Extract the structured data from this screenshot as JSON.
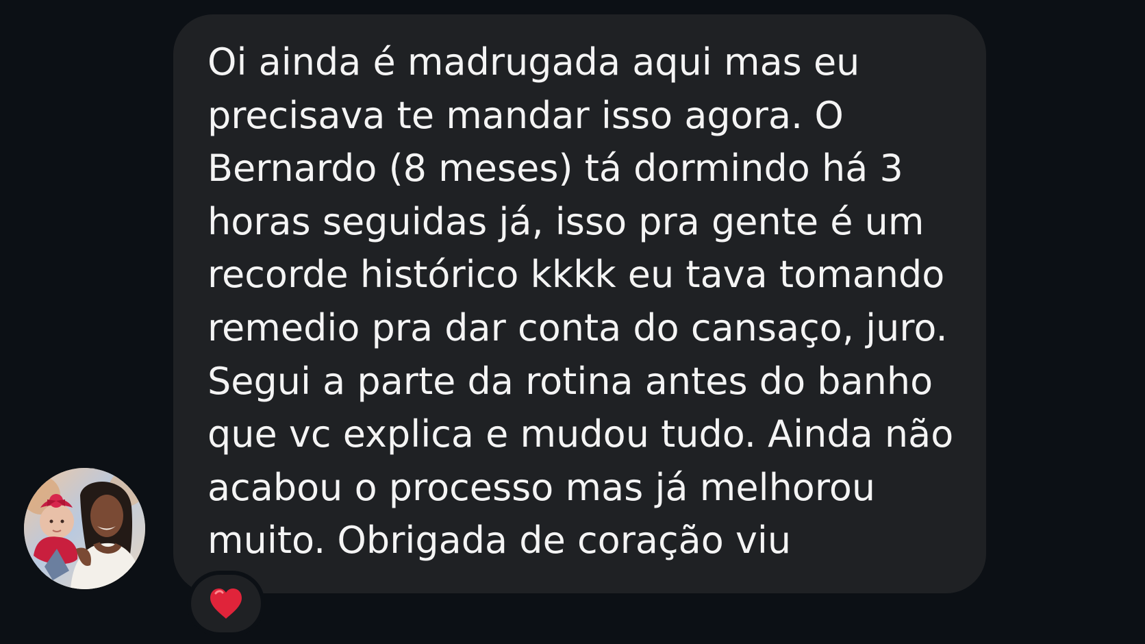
{
  "message": {
    "lines": [
      "Oi ainda é madrugada aqui mas eu",
      "precisava te mandar isso agora. O",
      "Bernardo (8 meses) tá dormindo há 3",
      "horas seguidas já, isso pra gente é um",
      "recorde histórico kkkk eu tava tomando",
      "remedio pra dar conta do cansaço, juro.",
      "Segui a parte da rotina antes do banho",
      "que vc explica e mudou tudo. Ainda não",
      "acabou o processo mas já melhorou",
      "muito. Obrigada de coração viu"
    ],
    "reaction": "heart",
    "reaction_color": "#e0243a"
  },
  "sender": {
    "avatar": "profile-photo"
  },
  "colors": {
    "background": "#0c1015",
    "bubble": "#1f2124",
    "text": "#f4f4f4"
  }
}
